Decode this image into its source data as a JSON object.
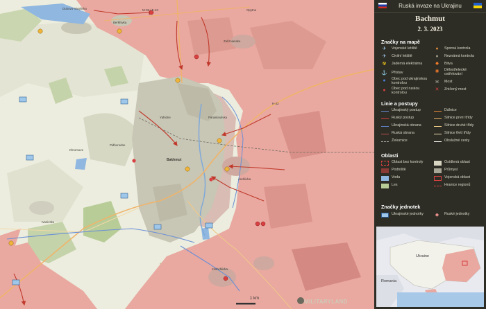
{
  "header": {
    "title": "Ruská invaze na Ukrajinu"
  },
  "map_title": {
    "city": "Bachmut",
    "date": "2. 3. 2023"
  },
  "legend": {
    "sections": {
      "znacky": "Značky na mapě",
      "linie": "Linie a postupy",
      "oblasti": "Oblasti",
      "jednotky": "Značky jednotek"
    },
    "znacky_left": [
      "Vojenské letiště",
      "Civilní letiště",
      "Jaderná elektrárna",
      "Přístav",
      "Obec pod ukrajinskou kontrolou",
      "Obec pod ruskou kontrolou"
    ],
    "znacky_right": [
      "Sporná kontrola",
      "Neznámá kontrola",
      "Bitva",
      "Dělostřelecké ostřelování",
      "Most",
      "Zničený most"
    ],
    "linie_left": [
      "Ukrajinský postup",
      "Ruský postup",
      "Ukrajinská obrana",
      "Ruská obrana",
      "Železnice"
    ],
    "linie_right": [
      "Dálnice",
      "Silnice první třídy",
      "Silnice druhé třídy",
      "Silnice třetí třídy",
      "Obslužné cesty"
    ],
    "oblasti_left": [
      "Oblast bez kontroly",
      "Podniště",
      "Voda",
      "Les"
    ],
    "oblasti_right": [
      "Osídlená oblast",
      "Průmysl",
      "Vojenská oblast",
      "Hranice regionů"
    ],
    "jednotky": [
      "Ukrajinské jednotky",
      "Ruské jednotky"
    ]
  },
  "inset": {
    "labels": [
      "Ukraine",
      "Romania"
    ]
  },
  "map_labels": [
    "Bakhmut",
    "Berkhivka",
    "Pidhorodne",
    "Zaliznianske",
    "Khromove",
    "Ivanivske",
    "Paraskoviivka",
    "Opytne",
    "Klishchiivka",
    "Andriivka",
    "Ozarianivka",
    "Novoselivka",
    "Orikhovo-Vasylivka",
    "Dubovo-Vasylivka",
    "Yahidne",
    "Krasna Hora",
    "Stupky",
    "Ivanivske",
    "Chasiv Yar"
  ],
  "road_labels": [
    "M-03 / E-40",
    "T0513",
    "H-32",
    "T0504"
  ],
  "scale": "1 km",
  "brand": "MILITARYLAND",
  "colors": {
    "russian": "#e9a8a0",
    "ukrainian_line": "#6b8fd6",
    "panel_bg": "#2d2d25",
    "urban": "#c8c6b5",
    "field": "#eeeee2"
  }
}
